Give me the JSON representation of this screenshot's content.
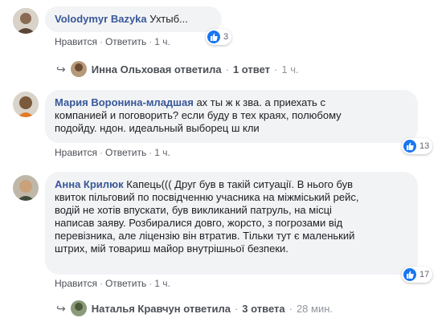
{
  "comments": [
    {
      "author": "Volodymyr Bazyka",
      "text": "Ухтыб...",
      "actions": {
        "like": "Нравится",
        "reply": "Ответить",
        "time": "1 ч."
      },
      "reactions": "3",
      "reply_preview": {
        "name": "Инна Ольховая ответила",
        "count": "1 ответ",
        "time": "1 ч."
      }
    },
    {
      "author": "Мария Воронина-младшая",
      "text_lines": [
        "ах ты ж к  зва. а приехать с",
        "компанией и поговорить? если буду в тех краях, полюбому",
        "подойду.  ндон. идеальный выборец ш   кли"
      ],
      "actions": {
        "like": "Нравится",
        "reply": "Ответить",
        "time": "1 ч."
      },
      "reactions": "13"
    },
    {
      "author": "Анна Крилюк",
      "text_lines": [
        "Капець((( Друг був в такій ситуації. В нього був",
        "квиток пільговий по посвідченню учасника на міжміський рейс,",
        "водій не хотів впускати, був викликаний патруль, на місці",
        "написав заяву. Розбиралися довго, жорсто, з погрозами від",
        "перевізника, але ліцензію він втратив. Тільки тут є маленький",
        "штрих, мій товариш майор внутрішньої безпеки."
      ],
      "actions": {
        "like": "Нравится",
        "reply": "Ответить",
        "time": "1 ч."
      },
      "reactions": "17",
      "reply_preview": {
        "name": "Наталья Кравчун ответила",
        "count": "3 ответа",
        "time": "28 мин."
      }
    }
  ],
  "colors": {
    "link": "#385898",
    "bubble": "#f2f3f5",
    "like": "#1877f2"
  },
  "icons": {
    "reply_arrow": "reply-arrow-icon",
    "like": "like-thumb-icon"
  }
}
